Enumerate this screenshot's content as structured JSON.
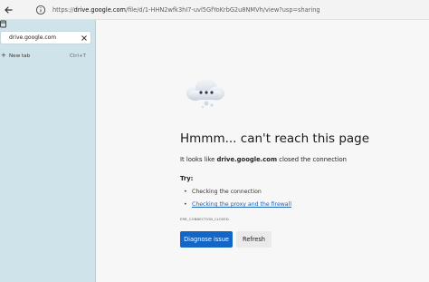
{
  "address_bar": {
    "url_prefix": "https://",
    "url_domain": "drive.google.com",
    "url_path": "/file/d/1-HHN2wfk3hI7-uvl5GfYoKrbG2u8NMVh/view?usp=sharing"
  },
  "sidebar": {
    "active_tab_label": "drive.google.com",
    "new_tab_label": "New tab",
    "new_tab_shortcut": "Ctrl+T"
  },
  "error_page": {
    "title": "Hmmm... can't reach this page",
    "desc_prefix": "It looks like ",
    "desc_domain": "drive.google.com",
    "desc_suffix": " closed the connection",
    "try_label": "Try:",
    "suggestions": [
      "Checking the connection",
      "Checking the proxy and the firewall"
    ],
    "error_code": "ERR_CONNECTION_CLOSED",
    "diagnose_button": "Diagnose issue",
    "refresh_button": "Refresh"
  },
  "colors": {
    "sidebar_bg": "#cfe3ea",
    "primary_button": "#1366c6",
    "link": "#2064b8"
  },
  "icons": {
    "back": "back-arrow-icon",
    "tabs": "tab-actions-icon",
    "site_info": "info-icon",
    "close_tab": "close-icon",
    "new_tab": "plus-icon",
    "error": "cloud-error-icon"
  }
}
